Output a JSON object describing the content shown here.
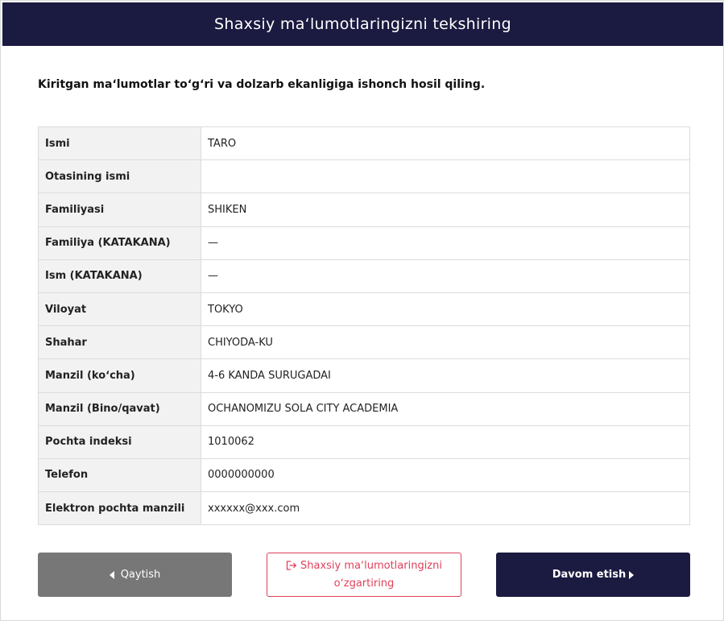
{
  "header": {
    "title": "Shaxsiy maʻlumotlaringizni tekshiring"
  },
  "intro": "Kiritgan maʻlumotlar toʻgʻri va dolzarb ekanligiga ishonch hosil qiling.",
  "rows": [
    {
      "label": "Ismi",
      "value": "TARO"
    },
    {
      "label": "Otasining ismi",
      "value": ""
    },
    {
      "label": "Familiyasi",
      "value": "SHIKEN"
    },
    {
      "label": "Familiya (KATAKANA)",
      "value": "—"
    },
    {
      "label": "Ism (KATAKANA)",
      "value": "—"
    },
    {
      "label": "Viloyat",
      "value": "TOKYO"
    },
    {
      "label": "Shahar",
      "value": "CHIYODA-KU"
    },
    {
      "label": "Manzil (koʻcha)",
      "value": "4-6 KANDA SURUGADAI"
    },
    {
      "label": "Manzil (Bino/qavat)",
      "value": "OCHANOMIZU SOLA CITY ACADEMIA"
    },
    {
      "label": "Pochta indeksi",
      "value": "1010062"
    },
    {
      "label": "Telefon",
      "value": "0000000000"
    },
    {
      "label": "Elektron pochta manzili",
      "value": "xxxxxx@xxx.com"
    }
  ],
  "buttons": {
    "back_label": "Qaytish",
    "edit_label_line1": "Shaxsiy maʻlumotlaringizni",
    "edit_label_line2": "oʻzgartiring",
    "next_label": "Davom etish"
  },
  "icons": {
    "back": "caret-left-icon",
    "edit": "sign-out-icon",
    "next": "caret-right-icon"
  },
  "colors": {
    "header_bg": "#1b1a40",
    "back_bg": "#777777",
    "edit_accent": "#e0405a",
    "next_bg": "#1b1a40"
  }
}
